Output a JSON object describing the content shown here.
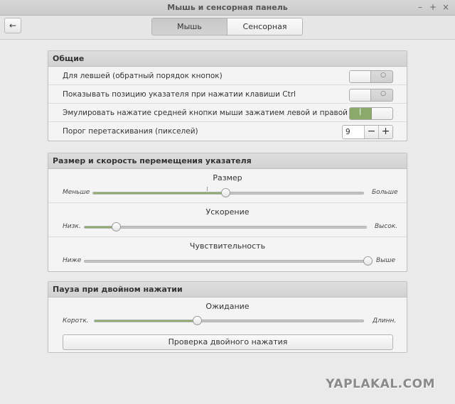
{
  "window": {
    "title": "Мышь и сенсорная панель",
    "controls": {
      "minimize": "–",
      "maximize": "+",
      "close": "×"
    }
  },
  "toolbar": {
    "back_icon": "←",
    "tabs": [
      {
        "label": "Мышь",
        "active": true
      },
      {
        "label": "Сенсорная панель",
        "active": false
      }
    ]
  },
  "general": {
    "header": "Общие",
    "left_handed": {
      "label": "Для левшей (обратный порядок кнопок)",
      "enabled": false,
      "off_mark": "○"
    },
    "show_pointer_ctrl": {
      "label": "Показывать позицию указателя при нажатии клавиши Ctrl",
      "enabled": false,
      "off_mark": "○"
    },
    "middle_click_emulation": {
      "label": "Эмулировать нажатие средней кнопки мыши зажатием левой и правой кнопок",
      "enabled": true,
      "on_mark": "|"
    },
    "drag_threshold": {
      "label": "Порог перетаскивания (пикселей)",
      "value": "9",
      "minus": "−",
      "plus": "+"
    }
  },
  "pointer": {
    "header": "Размер и скорость перемещения указателя",
    "size": {
      "title": "Размер",
      "min_label": "Меньше",
      "max_label": "Больше",
      "fraction": 0.49,
      "default_mark_fraction": 0.42
    },
    "acceleration": {
      "title": "Ускорение",
      "min_label": "Низк.",
      "max_label": "Высок.",
      "fraction": 0.11
    },
    "sensitivity": {
      "title": "Чувствительность",
      "min_label": "Ниже",
      "max_label": "Выше",
      "fraction": 1.0
    }
  },
  "double_click": {
    "header": "Пауза при двойном нажатии",
    "timeout": {
      "title": "Ожидание",
      "min_label": "Коротк.",
      "max_label": "Длинн.",
      "fraction": 0.38
    },
    "test_button": "Проверка двойного нажатия"
  },
  "watermark": "YAPLAKAL.COM",
  "colors": {
    "accent": "#8fae6e",
    "toggle_on": "#8aa96a"
  }
}
